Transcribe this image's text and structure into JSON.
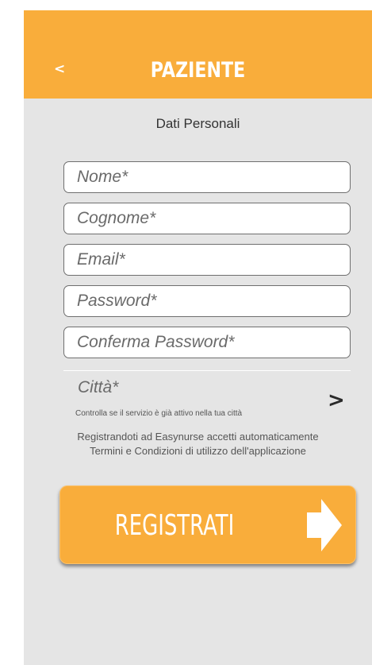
{
  "header": {
    "back_label": "<",
    "title": "PAZIENTE"
  },
  "section_title": "Dati Personali",
  "form": {
    "nome": {
      "placeholder": "Nome*",
      "value": ""
    },
    "cognome": {
      "placeholder": "Cognome*",
      "value": ""
    },
    "email": {
      "placeholder": "Email*",
      "value": ""
    },
    "password": {
      "placeholder": "Password*",
      "value": ""
    },
    "conferma_password": {
      "placeholder": "Conferma Password*",
      "value": ""
    }
  },
  "city": {
    "label": "Città*",
    "hint": "Controlla se il servizio è già attivo nella tua città",
    "arrow": ">"
  },
  "terms": {
    "line1": "Registrandoti ad Easynurse accetti automaticamente",
    "line2": "Termini e Condizioni di utilizzo dell'applicazione"
  },
  "register_button": {
    "label": "REGISTRATI",
    "icon": "arrow-right-icon"
  },
  "colors": {
    "accent": "#f9ad3b",
    "background": "#e5e5e5",
    "field_border": "#6f6f6f"
  }
}
